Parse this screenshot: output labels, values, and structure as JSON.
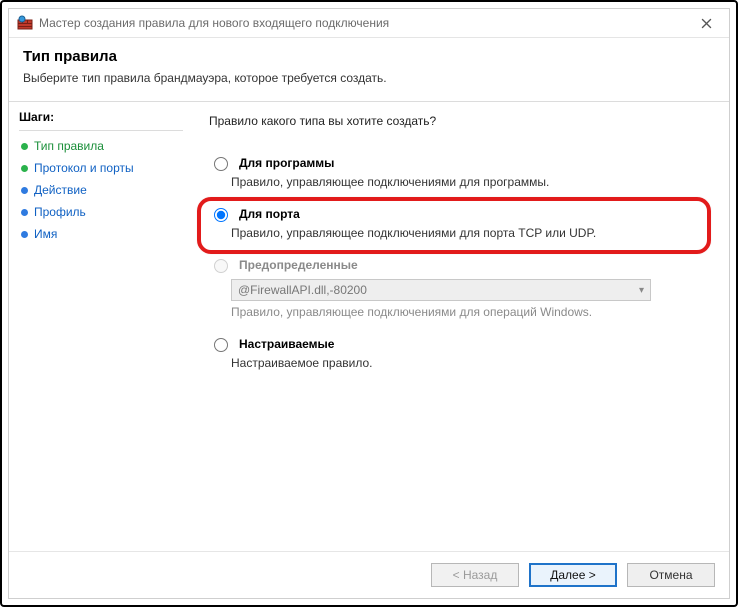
{
  "window": {
    "title": "Мастер создания правила для нового входящего подключения"
  },
  "header": {
    "title": "Тип правила",
    "subtitle": "Выберите тип правила брандмауэра, которое требуется создать."
  },
  "steps": {
    "title": "Шаги:",
    "items": [
      {
        "label": "Тип правила",
        "bullet": "green",
        "cls": "active-green"
      },
      {
        "label": "Протокол и порты",
        "bullet": "green",
        "cls": "link"
      },
      {
        "label": "Действие",
        "bullet": "blue",
        "cls": "plain"
      },
      {
        "label": "Профиль",
        "bullet": "blue",
        "cls": "plain"
      },
      {
        "label": "Имя",
        "bullet": "blue",
        "cls": "plain"
      }
    ]
  },
  "content": {
    "question": "Правило какого типа вы хотите создать?",
    "options": [
      {
        "key": "program",
        "title": "Для программы",
        "desc": "Правило, управляющее подключениями для программы.",
        "checked": false,
        "disabled": false
      },
      {
        "key": "port",
        "title": "Для порта",
        "desc": "Правило, управляющее подключениями для порта TCP или UDP.",
        "checked": true,
        "disabled": false
      },
      {
        "key": "predefined",
        "title": "Предопределенные",
        "desc": "Правило, управляющее подключениями для операций Windows.",
        "checked": false,
        "disabled": true,
        "combo_value": "@FirewallAPI.dll,-80200"
      },
      {
        "key": "custom",
        "title": "Настраиваемые",
        "desc": "Настраиваемое правило.",
        "checked": false,
        "disabled": false
      }
    ]
  },
  "footer": {
    "back": "< Назад",
    "next": "Далее >",
    "cancel": "Отмена"
  }
}
